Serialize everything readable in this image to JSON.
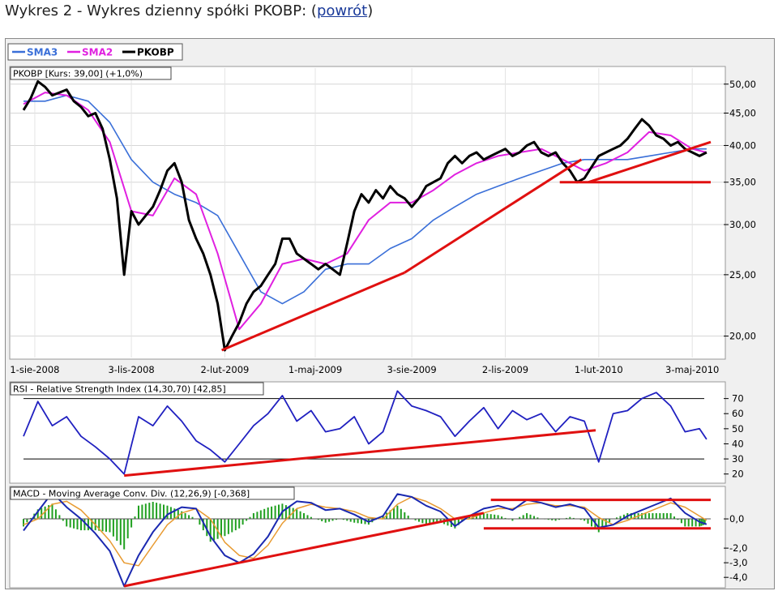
{
  "page": {
    "title_prefix": "Wykres 2 - Wykres dzienny spółki PKOBP: (",
    "back_link": "powrót",
    "title_suffix": ")"
  },
  "colors": {
    "sma3": "#3a6fd8",
    "sma2": "#e020e0",
    "price": "#000000",
    "trend": "#e01010",
    "rsi": "#2020c0",
    "macd": "#1a28b0",
    "signal": "#e89a30",
    "hist": "#20a020"
  },
  "chart_data": [
    {
      "type": "line",
      "panel": "price",
      "legend": [
        "SMA3",
        "SMA2",
        "PKOBP"
      ],
      "title": "PKOBP [Kurs: 39,00] (+1,0%)",
      "ylim": [
        18.5,
        53
      ],
      "y_scale": "log",
      "y_ticks": [
        "50,00",
        "45,00",
        "40,00",
        "35,00",
        "30,00",
        "25,00",
        "20,00"
      ],
      "y_tick_values": [
        50,
        45,
        40,
        35,
        30,
        25,
        20
      ],
      "x_ticks": [
        "1-sie-2008",
        "3-lis-2008",
        "2-lut-2009",
        "1-maj-2009",
        "3-sie-2009",
        "2-lis-2009",
        "1-lut-2010",
        "3-maj-2010"
      ],
      "x_range": [
        "2008-07-21",
        "2010-05-21"
      ],
      "series": [
        {
          "name": "PKOBP",
          "x": [
            "2008-07-21",
            "2008-07-28",
            "2008-08-04",
            "2008-08-11",
            "2008-08-18",
            "2008-08-25",
            "2008-09-01",
            "2008-09-08",
            "2008-09-15",
            "2008-09-22",
            "2008-09-29",
            "2008-10-06",
            "2008-10-13",
            "2008-10-20",
            "2008-10-27",
            "2008-11-03",
            "2008-11-10",
            "2008-11-17",
            "2008-11-24",
            "2008-12-01",
            "2008-12-08",
            "2008-12-15",
            "2008-12-22",
            "2008-12-29",
            "2009-01-05",
            "2009-01-12",
            "2009-01-19",
            "2009-01-26",
            "2009-02-02",
            "2009-02-09",
            "2009-02-16",
            "2009-02-23",
            "2009-03-02",
            "2009-03-09",
            "2009-03-16",
            "2009-03-23",
            "2009-03-30",
            "2009-04-06",
            "2009-04-13",
            "2009-04-20",
            "2009-04-27",
            "2009-05-04",
            "2009-05-11",
            "2009-05-18",
            "2009-05-25",
            "2009-06-01",
            "2009-06-08",
            "2009-06-15",
            "2009-06-22",
            "2009-06-29",
            "2009-07-06",
            "2009-07-13",
            "2009-07-20",
            "2009-07-27",
            "2009-08-03",
            "2009-08-10",
            "2009-08-17",
            "2009-08-24",
            "2009-08-31",
            "2009-09-07",
            "2009-09-14",
            "2009-09-21",
            "2009-09-28",
            "2009-10-05",
            "2009-10-12",
            "2009-10-19",
            "2009-10-26",
            "2009-11-02",
            "2009-11-09",
            "2009-11-16",
            "2009-11-23",
            "2009-11-30",
            "2009-12-07",
            "2009-12-14",
            "2009-12-21",
            "2009-12-28",
            "2010-01-04",
            "2010-01-11",
            "2010-01-18",
            "2010-01-25",
            "2010-02-01",
            "2010-02-08",
            "2010-02-15",
            "2010-02-22",
            "2010-03-01",
            "2010-03-08",
            "2010-03-15",
            "2010-03-22",
            "2010-03-29",
            "2010-04-05",
            "2010-04-12",
            "2010-04-19",
            "2010-04-26",
            "2010-05-03",
            "2010-05-10",
            "2010-05-17"
          ],
          "values": [
            45.5,
            47.5,
            50.5,
            49.5,
            48.0,
            48.5,
            49.0,
            47.0,
            46.0,
            44.5,
            45.0,
            42.5,
            38.0,
            33.0,
            25.0,
            31.5,
            30.0,
            31.0,
            32.0,
            34.0,
            36.5,
            37.5,
            35.0,
            30.5,
            28.5,
            27.0,
            25.0,
            22.5,
            19.0,
            20.0,
            21.0,
            22.5,
            23.5,
            24.0,
            25.0,
            26.0,
            28.5,
            28.5,
            27.0,
            26.5,
            26.0,
            25.5,
            26.0,
            25.5,
            25.0,
            28.0,
            31.5,
            33.5,
            32.5,
            34.0,
            33.0,
            34.5,
            33.5,
            33.0,
            32.0,
            33.0,
            34.5,
            35.0,
            35.5,
            37.5,
            38.5,
            37.5,
            38.5,
            39.0,
            38.0,
            38.5,
            39.0,
            39.5,
            38.5,
            39.0,
            40.0,
            40.5,
            39.0,
            38.5,
            39.0,
            37.5,
            36.5,
            35.0,
            35.5,
            37.0,
            38.5,
            39.0,
            39.5,
            40.0,
            41.0,
            42.5,
            44.0,
            43.0,
            41.5,
            41.0,
            40.0,
            40.5,
            39.5,
            39.0,
            38.5,
            39.0
          ]
        },
        {
          "name": "SMA2",
          "x": [
            "2008-07-21",
            "2008-08-11",
            "2008-09-01",
            "2008-09-22",
            "2008-10-13",
            "2008-11-03",
            "2008-11-24",
            "2008-12-15",
            "2009-01-05",
            "2009-01-26",
            "2009-02-16",
            "2009-03-09",
            "2009-03-30",
            "2009-04-20",
            "2009-05-11",
            "2009-06-01",
            "2009-06-22",
            "2009-07-13",
            "2009-08-03",
            "2009-08-24",
            "2009-09-14",
            "2009-10-05",
            "2009-10-26",
            "2009-11-16",
            "2009-12-07",
            "2009-12-28",
            "2010-01-18",
            "2010-02-08",
            "2010-03-01",
            "2010-03-22",
            "2010-04-12",
            "2010-05-03",
            "2010-05-17"
          ],
          "values": [
            46.5,
            48.5,
            48.0,
            45.5,
            40.5,
            31.5,
            31.0,
            35.5,
            33.5,
            27.0,
            20.5,
            22.5,
            26.0,
            26.5,
            26.0,
            27.0,
            30.5,
            32.5,
            32.5,
            34.0,
            36.0,
            37.5,
            38.5,
            39.0,
            39.5,
            38.0,
            36.5,
            37.5,
            39.0,
            42.0,
            41.5,
            39.5,
            39.0
          ]
        },
        {
          "name": "SMA3",
          "x": [
            "2008-07-21",
            "2008-08-11",
            "2008-09-01",
            "2008-09-22",
            "2008-10-13",
            "2008-11-03",
            "2008-11-24",
            "2008-12-15",
            "2009-01-05",
            "2009-01-26",
            "2009-02-16",
            "2009-03-09",
            "2009-03-30",
            "2009-04-20",
            "2009-05-11",
            "2009-06-01",
            "2009-06-22",
            "2009-07-13",
            "2009-08-03",
            "2009-08-24",
            "2009-09-14",
            "2009-10-05",
            "2009-10-26",
            "2009-11-16",
            "2009-12-07",
            "2009-12-28",
            "2010-01-18",
            "2010-02-08",
            "2010-03-01",
            "2010-03-22",
            "2010-04-12",
            "2010-05-03",
            "2010-05-17"
          ],
          "values": [
            47.0,
            47.0,
            48.0,
            47.0,
            43.5,
            38.0,
            35.0,
            33.5,
            32.5,
            31.0,
            27.0,
            23.5,
            22.5,
            23.5,
            25.5,
            26.0,
            26.0,
            27.5,
            28.5,
            30.5,
            32.0,
            33.5,
            34.5,
            35.5,
            36.5,
            37.5,
            38.0,
            38.0,
            38.0,
            38.5,
            39.0,
            39.5,
            39.5
          ]
        }
      ],
      "trendlines": [
        {
          "x": [
            "2009-01-30",
            "2009-07-27"
          ],
          "values": [
            19.0,
            25.2
          ]
        },
        {
          "x": [
            "2009-07-27",
            "2010-01-15"
          ],
          "values": [
            25.2,
            38.0
          ]
        },
        {
          "x": [
            "2010-01-22",
            "2010-05-21"
          ],
          "values": [
            35.0,
            40.5
          ]
        },
        {
          "x": [
            "2009-12-25",
            "2010-05-21"
          ],
          "values": [
            35.0,
            35.0
          ]
        }
      ]
    },
    {
      "type": "line",
      "panel": "rsi",
      "title": "RSI - Relative Strength Index (14,30,70) [42,85]",
      "ylim": [
        15,
        80
      ],
      "y_ticks": [
        "70",
        "60",
        "50",
        "40",
        "30",
        "20"
      ],
      "y_tick_values": [
        70,
        60,
        50,
        40,
        30,
        20
      ],
      "reference_lines": [
        70,
        30
      ],
      "series": [
        {
          "name": "RSI",
          "x": [
            "2008-07-21",
            "2008-08-04",
            "2008-08-18",
            "2008-09-01",
            "2008-09-15",
            "2008-09-29",
            "2008-10-13",
            "2008-10-27",
            "2008-11-10",
            "2008-11-24",
            "2008-12-08",
            "2008-12-22",
            "2009-01-05",
            "2009-01-19",
            "2009-02-02",
            "2009-02-16",
            "2009-03-02",
            "2009-03-16",
            "2009-03-30",
            "2009-04-13",
            "2009-04-27",
            "2009-05-11",
            "2009-05-25",
            "2009-06-08",
            "2009-06-22",
            "2009-07-06",
            "2009-07-20",
            "2009-08-03",
            "2009-08-17",
            "2009-08-31",
            "2009-09-14",
            "2009-09-28",
            "2009-10-12",
            "2009-10-26",
            "2009-11-09",
            "2009-11-23",
            "2009-12-07",
            "2009-12-21",
            "2010-01-04",
            "2010-01-18",
            "2010-02-01",
            "2010-02-15",
            "2010-03-01",
            "2010-03-15",
            "2010-03-29",
            "2010-04-12",
            "2010-04-26",
            "2010-05-10",
            "2010-05-17"
          ],
          "values": [
            45,
            68,
            52,
            58,
            45,
            38,
            30,
            20,
            58,
            52,
            65,
            55,
            42,
            36,
            28,
            40,
            52,
            60,
            72,
            55,
            62,
            48,
            50,
            58,
            40,
            48,
            75,
            65,
            62,
            58,
            45,
            55,
            64,
            50,
            62,
            56,
            60,
            48,
            58,
            55,
            28,
            60,
            62,
            70,
            74,
            65,
            48,
            50,
            43
          ]
        }
      ],
      "trendlines": [
        {
          "x": [
            "2008-10-27",
            "2010-01-29"
          ],
          "values": [
            19.0,
            49.0
          ]
        }
      ]
    },
    {
      "type": "line",
      "panel": "macd",
      "title": "MACD - Moving Average Conv. Div. (12,26,9) [-0,368]",
      "ylim": [
        -4.6,
        2.0
      ],
      "y_ticks": [
        "0,0",
        "-2,0",
        "-3,0",
        "-4,0"
      ],
      "y_tick_values": [
        0,
        -2,
        -3,
        -4
      ],
      "series": [
        {
          "name": "MACD",
          "x": [
            "2008-07-21",
            "2008-08-04",
            "2008-08-18",
            "2008-09-01",
            "2008-09-15",
            "2008-09-29",
            "2008-10-13",
            "2008-10-27",
            "2008-11-10",
            "2008-11-24",
            "2008-12-08",
            "2008-12-22",
            "2009-01-05",
            "2009-01-19",
            "2009-02-02",
            "2009-02-16",
            "2009-03-02",
            "2009-03-16",
            "2009-03-30",
            "2009-04-13",
            "2009-04-27",
            "2009-05-11",
            "2009-05-25",
            "2009-06-08",
            "2009-06-22",
            "2009-07-06",
            "2009-07-20",
            "2009-08-03",
            "2009-08-17",
            "2009-08-31",
            "2009-09-14",
            "2009-09-28",
            "2009-10-12",
            "2009-10-26",
            "2009-11-09",
            "2009-11-23",
            "2009-12-07",
            "2009-12-21",
            "2010-01-04",
            "2010-01-18",
            "2010-02-01",
            "2010-02-15",
            "2010-03-01",
            "2010-03-15",
            "2010-03-29",
            "2010-04-12",
            "2010-04-26",
            "2010-05-10",
            "2010-05-17"
          ],
          "values": [
            -0.8,
            0.5,
            1.8,
            0.8,
            0.0,
            -1.0,
            -2.2,
            -4.6,
            -2.5,
            -0.9,
            0.3,
            0.8,
            0.7,
            -1.2,
            -2.5,
            -3.0,
            -2.4,
            -1.2,
            0.5,
            1.2,
            1.1,
            0.6,
            0.7,
            0.3,
            -0.2,
            0.2,
            1.7,
            1.5,
            0.9,
            0.5,
            -0.5,
            0.2,
            0.7,
            0.9,
            0.6,
            1.3,
            1.1,
            0.8,
            1.0,
            0.7,
            -0.6,
            -0.4,
            0.2,
            0.6,
            1.0,
            1.4,
            0.4,
            -0.2,
            -0.37
          ]
        },
        {
          "name": "Signal",
          "x": [
            "2008-07-21",
            "2008-08-04",
            "2008-08-18",
            "2008-09-01",
            "2008-09-15",
            "2008-09-29",
            "2008-10-13",
            "2008-10-27",
            "2008-11-10",
            "2008-11-24",
            "2008-12-08",
            "2008-12-22",
            "2009-01-05",
            "2009-01-19",
            "2009-02-02",
            "2009-02-16",
            "2009-03-02",
            "2009-03-16",
            "2009-03-30",
            "2009-04-13",
            "2009-04-27",
            "2009-05-11",
            "2009-05-25",
            "2009-06-08",
            "2009-06-22",
            "2009-07-06",
            "2009-07-20",
            "2009-08-03",
            "2009-08-17",
            "2009-08-31",
            "2009-09-14",
            "2009-09-28",
            "2009-10-12",
            "2009-10-26",
            "2009-11-09",
            "2009-11-23",
            "2009-12-07",
            "2009-12-21",
            "2010-01-04",
            "2010-01-18",
            "2010-02-01",
            "2010-02-15",
            "2010-03-01",
            "2010-03-15",
            "2010-03-29",
            "2010-04-12",
            "2010-04-26",
            "2010-05-10",
            "2010-05-17"
          ],
          "values": [
            -0.4,
            0.0,
            1.0,
            1.2,
            0.6,
            -0.4,
            -1.5,
            -3.0,
            -3.2,
            -1.8,
            -0.4,
            0.4,
            0.7,
            0.0,
            -1.6,
            -2.5,
            -2.7,
            -1.8,
            -0.3,
            0.7,
            1.0,
            0.8,
            0.7,
            0.5,
            0.1,
            0.0,
            1.0,
            1.5,
            1.2,
            0.7,
            0.0,
            0.0,
            0.4,
            0.7,
            0.7,
            1.0,
            1.1,
            0.9,
            0.9,
            0.8,
            0.1,
            -0.4,
            -0.1,
            0.3,
            0.7,
            1.1,
            0.8,
            0.2,
            -0.1
          ]
        }
      ],
      "trendlines": [
        {
          "x": [
            "2008-10-27",
            "2009-10-12"
          ],
          "values": [
            -4.6,
            0.4
          ]
        },
        {
          "x": [
            "2009-10-19",
            "2010-05-21"
          ],
          "values": [
            1.3,
            1.3
          ]
        },
        {
          "x": [
            "2009-10-12",
            "2010-05-21"
          ],
          "values": [
            -0.65,
            -0.65
          ]
        }
      ]
    }
  ]
}
